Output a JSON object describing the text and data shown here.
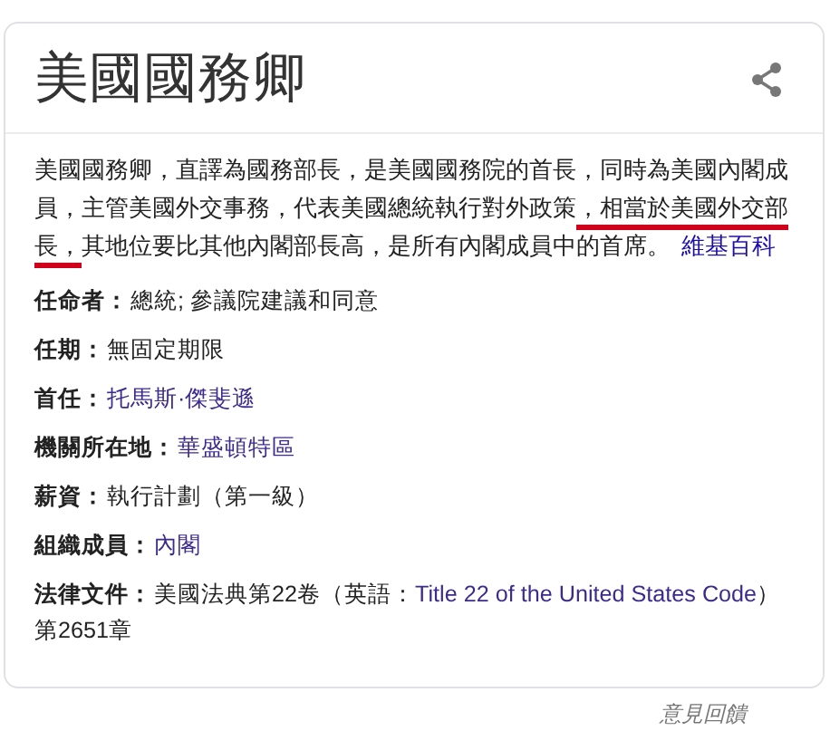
{
  "title": "美國國務卿",
  "description": {
    "segments": [
      {
        "text": "美國國務卿，直譯為國務部長，是美國國務院的首長，同時為美國內閣成員，主管美國外交事務，代表美國總統執行對外政策",
        "underlined": false
      },
      {
        "text": "，相當於美國外交部長，",
        "underlined": true
      },
      {
        "text": "其地位要比其他內閣部長高，是所有內閣成員中的首席。",
        "underlined": false
      }
    ],
    "source": "維基百科"
  },
  "facts": [
    {
      "label": "任命者：",
      "value": [
        {
          "text": "總統; 參議院建議和同意",
          "link": false
        }
      ]
    },
    {
      "label": "任期：",
      "value": [
        {
          "text": "無固定期限",
          "link": false
        }
      ]
    },
    {
      "label": "首任：",
      "value": [
        {
          "text": "托馬斯·傑斐遜",
          "link": true
        }
      ]
    },
    {
      "label": "機關所在地：",
      "value": [
        {
          "text": "華盛頓特區",
          "link": true
        }
      ]
    },
    {
      "label": "薪資：",
      "value": [
        {
          "text": "執行計劃（第一級）",
          "link": false
        }
      ]
    },
    {
      "label": "組織成員：",
      "value": [
        {
          "text": "內閣",
          "link": true
        }
      ]
    },
    {
      "label": "法律文件：",
      "value": [
        {
          "text": "美國法典第22卷（英語：",
          "link": false
        },
        {
          "text": "Title 22 of the United States Code",
          "link": true
        },
        {
          "text": "）",
          "link": false
        },
        {
          "text": "第2651章",
          "link": false
        }
      ]
    }
  ],
  "feedback": "意見回饋"
}
